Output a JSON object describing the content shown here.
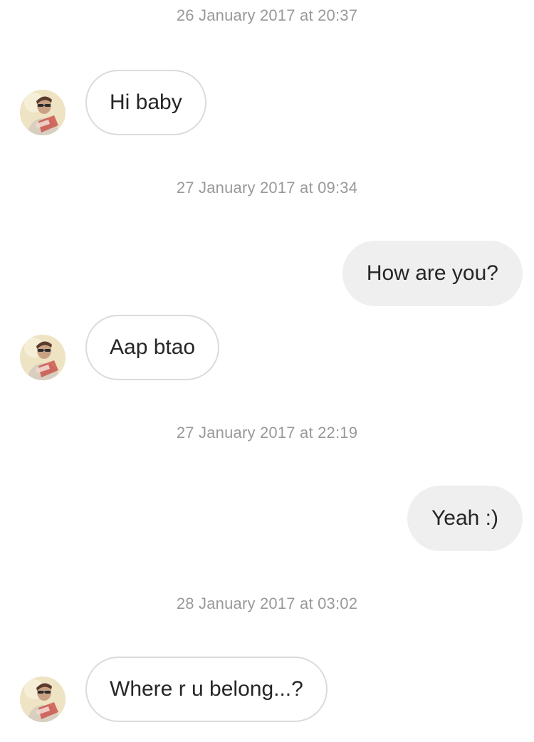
{
  "conversation": {
    "items": [
      {
        "kind": "timestamp",
        "text": "26 January 2017 at 20:37"
      },
      {
        "kind": "message",
        "direction": "incoming",
        "text": "Hi baby"
      },
      {
        "kind": "timestamp",
        "text": "27 January 2017 at 09:34"
      },
      {
        "kind": "message",
        "direction": "outgoing",
        "text": "How are you?"
      },
      {
        "kind": "message",
        "direction": "incoming",
        "text": "Aap btao"
      },
      {
        "kind": "timestamp",
        "text": "27 January 2017 at 22:19"
      },
      {
        "kind": "message",
        "direction": "outgoing",
        "text": "Yeah :)"
      },
      {
        "kind": "timestamp",
        "text": "28 January 2017 at 03:02"
      },
      {
        "kind": "message",
        "direction": "incoming",
        "text": "Where r u belong...?"
      }
    ]
  },
  "contact": {
    "avatar_icon": "user-avatar-photo"
  },
  "colors": {
    "incoming_bubble_border": "#dbdbdb",
    "outgoing_bubble_background": "#efefef",
    "timestamp_text": "#999999",
    "message_text": "#262626"
  }
}
